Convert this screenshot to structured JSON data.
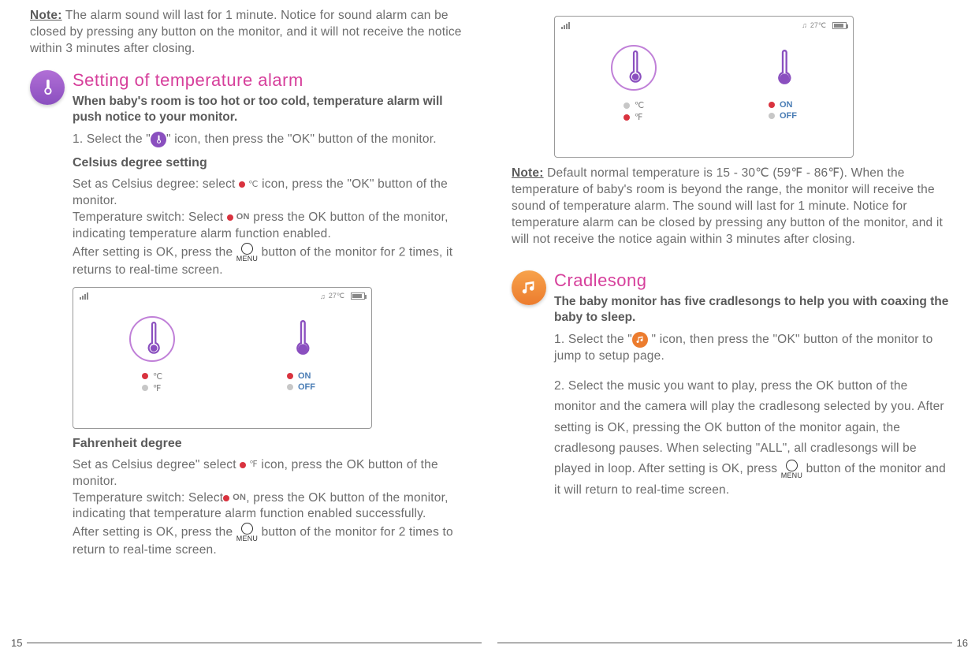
{
  "left": {
    "note_label": "Note:",
    "note_text": " The alarm sound will last for 1 minute. Notice for sound alarm can be closed by pressing any button on the monitor, and it will not receive the notice within 3 minutes after closing.",
    "section_title": "Setting of temperature alarm",
    "section_sub": "When baby's room is too hot or too cold, temperature alarm will push notice to your monitor.",
    "step1_a": "1. Select the \"",
    "step1_b": "\" icon, then press the \"OK\" button of the monitor.",
    "celsius_head": "Celsius degree setting",
    "celsius_p1_a": "Set as Celsius degree: select ",
    "celsius_p1_unit": "℃",
    "celsius_p1_b": " icon, press the \"OK\" button of the monitor.",
    "celsius_p2_a": "Temperature switch: Select ",
    "celsius_p2_on": "ON",
    "celsius_p2_b": " press the OK button of the monitor, indicating temperature alarm function enabled.",
    "celsius_p3_a": "After setting is OK, press the ",
    "celsius_p3_b": " button of the monitor for 2 times, it returns to real-time screen.",
    "fahr_head": "Fahrenheit degree",
    "fahr_p1_a": "Set as Celsius degree\" select ",
    "fahr_p1_unit": "℉",
    "fahr_p1_b": " icon, press the OK button of the monitor.",
    "fahr_p2_a": "Temperature switch: Select",
    "fahr_p2_on": " ON",
    "fahr_p2_b": ", press the OK button of the monitor, indicating that temperature alarm function enabled successfully.",
    "fahr_p3_a": "After setting is OK, press the ",
    "fahr_p3_b": " button of the monitor for 2 times to return to real-time screen.",
    "page_num": "15"
  },
  "right": {
    "note_label": "Note:",
    "note_text": " Default normal temperature is 15 - 30℃ (59℉ - 86℉). When the temperature of baby's room is beyond the range, the monitor will receive the sound of temperature alarm. The sound will last for 1 minute. Notice for temperature alarm can be closed by pressing any button of the monitor, and it will not receive the notice again within 3 minutes after closing.",
    "section_title": "Cradlesong",
    "section_sub": "The baby monitor has five cradlesongs to help you with coaxing the baby to sleep.",
    "step1_a": "1. Select the \"",
    "step1_b": " \" icon, then press the \"OK\" button of the monitor to jump to setup page.",
    "step2_a": "2. Select the music you want to play, press the OK button of the monitor and the camera will play the cradlesong selected by you. After setting is OK, pressing the OK button of the monitor again, the cradlesong pauses. When selecting \"ALL\", all cradlesongs will be played in loop. After setting is OK, press ",
    "step2_b": " button of the monitor and it will return to real-time screen.",
    "page_num": "16"
  },
  "screen": {
    "temp_status": "27℃",
    "unit_c": "℃",
    "unit_f": "℉",
    "on": "ON",
    "off": "OFF",
    "menu": "MENU"
  }
}
